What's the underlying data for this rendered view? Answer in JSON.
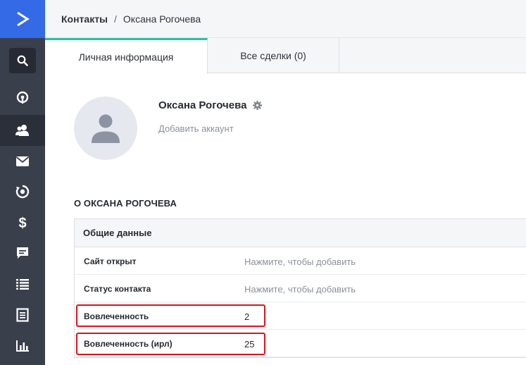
{
  "sidebar": {
    "items": [
      {
        "icon": "logo-arrow-icon"
      },
      {
        "icon": "search-icon"
      },
      {
        "icon": "map-pin-icon"
      },
      {
        "icon": "contacts-icon",
        "active": true
      },
      {
        "icon": "mail-icon"
      },
      {
        "icon": "automation-icon"
      },
      {
        "icon": "dollar-icon"
      },
      {
        "icon": "chat-icon"
      },
      {
        "icon": "list-icon"
      },
      {
        "icon": "document-icon"
      },
      {
        "icon": "bar-chart-icon"
      }
    ]
  },
  "breadcrumb": {
    "root": "Контакты",
    "separator": "/",
    "current": "Оксана Рогочева"
  },
  "tabs": [
    {
      "label": "Личная информация",
      "active": true
    },
    {
      "label": "Все сделки (0)",
      "active": false
    }
  ],
  "contact": {
    "name": "Оксана Рогочева",
    "add_account": "Добавить аккаунт"
  },
  "about": {
    "heading": "О ОКСАНА РОГОЧЕВА"
  },
  "general": {
    "title": "Общие данные",
    "rows": [
      {
        "label": "Сайт открыт",
        "value": "Нажмите, чтобы добавить",
        "placeholder": true
      },
      {
        "label": "Статус контакта",
        "value": "Нажмите, чтобы добавить",
        "placeholder": true
      },
      {
        "label": "Вовлеченность",
        "value": "2",
        "placeholder": false
      },
      {
        "label": "Вовлеченность (ирл)",
        "value": "25",
        "placeholder": false
      }
    ]
  },
  "colors": {
    "accent": "#356ae6",
    "tab_indicator": "#2dc0a5",
    "highlight": "#d9161c",
    "sidebar_bg": "#3a3f4c"
  }
}
